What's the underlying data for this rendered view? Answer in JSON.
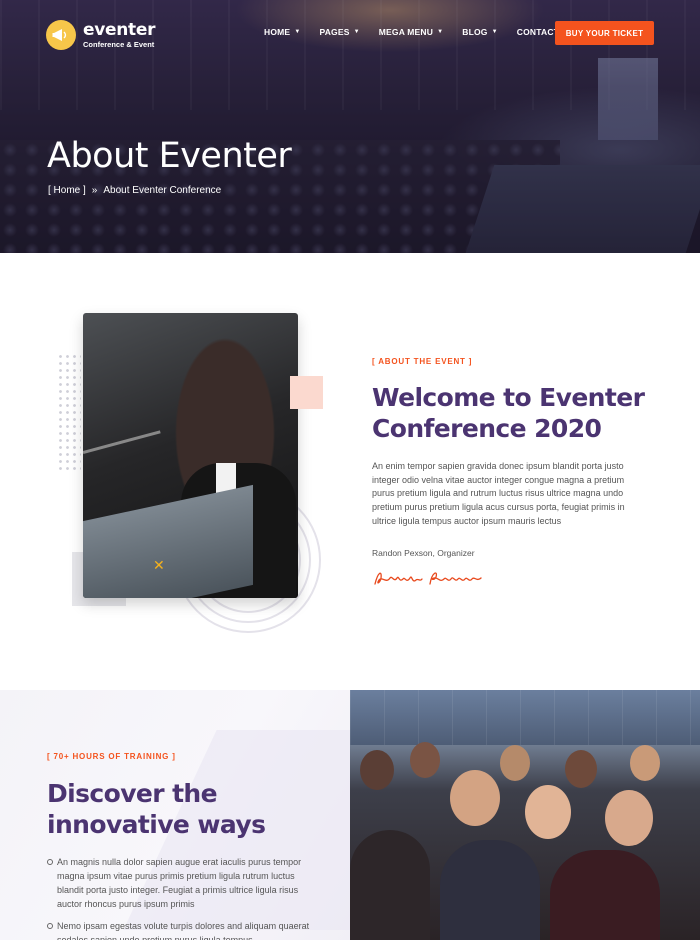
{
  "brand": {
    "name": "eventer",
    "tagline": "Conference & Event",
    "accent_color": "#f4531e",
    "heading_color": "#4b3471",
    "logo_color": "#f7c64a"
  },
  "nav": {
    "items": [
      {
        "label": "HOME"
      },
      {
        "label": "PAGES"
      },
      {
        "label": "MEGA MENU"
      },
      {
        "label": "BLOG"
      },
      {
        "label": "CONTACTS"
      }
    ],
    "cta_label": "BUY YOUR TICKET"
  },
  "hero": {
    "title": "About Eventer",
    "breadcrumb_home": "[ Home ]",
    "breadcrumb_separator": "»",
    "breadcrumb_current": "About Eventer Conference"
  },
  "about": {
    "eyebrow": "[ ABOUT THE EVENT ]",
    "title": "Welcome to Eventer Conference 2020",
    "text": "An enim tempor sapien gravida donec ipsum blandit porta justo integer odio velna vitae auctor integer congue magna a pretium purus pretium ligula and rutrum luctus risus ultrice magna undo pretium purus pretium ligula acus cursus porta, feugiat primis in ultrice ligula tempus auctor ipsum mauris lectus",
    "author": "Randon Pexson, Organizer",
    "signature": "Randon Pexson"
  },
  "discover": {
    "eyebrow": "[ 70+ HOURS OF TRAINING ]",
    "title": "Discover the innovative ways",
    "bullets": [
      "An magnis nulla dolor sapien augue erat iaculis purus tempor magna ipsum vitae purus primis pretium ligula rutrum luctus blandit porta justo integer. Feugiat a primis ultrice ligula risus auctor rhoncus purus ipsum primis",
      "Nemo ipsam egestas volute turpis dolores and aliquam quaerat sodales sapien undo pretium purus ligula tempus"
    ]
  }
}
